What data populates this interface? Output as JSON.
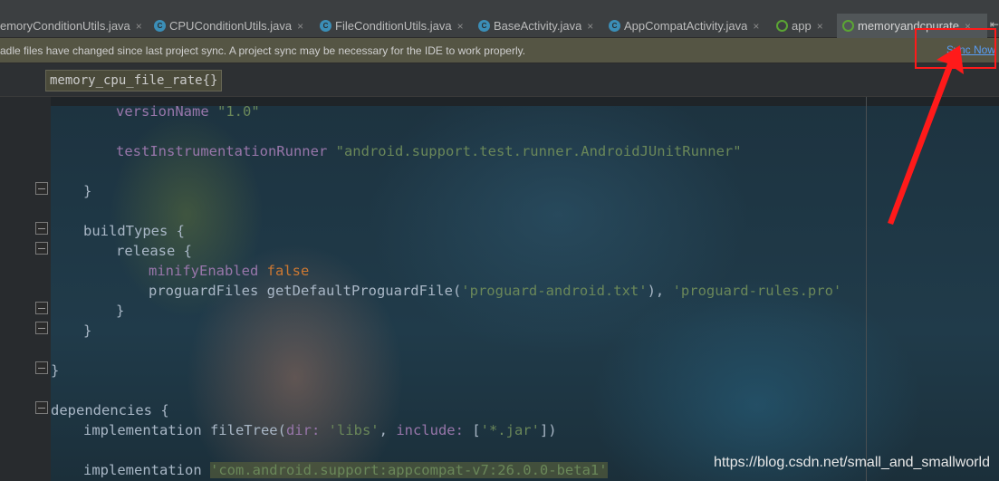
{
  "tabs": [
    {
      "label": "emoryConditionUtils.java",
      "icon": "java-class-icon",
      "active": false
    },
    {
      "label": "CPUConditionUtils.java",
      "icon": "java-class-icon",
      "active": false
    },
    {
      "label": "FileConditionUtils.java",
      "icon": "java-class-icon",
      "active": false
    },
    {
      "label": "BaseActivity.java",
      "icon": "java-class-icon",
      "active": false
    },
    {
      "label": "AppCompatActivity.java",
      "icon": "java-class-icon",
      "active": false
    },
    {
      "label": "app",
      "icon": "gradle-icon",
      "active": false
    },
    {
      "label": "memoryandcpurate",
      "icon": "gradle-icon",
      "active": true
    }
  ],
  "tab_close_glyph": "×",
  "tabs_overflow_glyph": "⇤",
  "notification": {
    "message": "adle files have changed since last project sync. A project sync may be necessary for the IDE to work properly.",
    "action_label": "Sync Now"
  },
  "breadcrumb": "memory_cpu_file_rate{}",
  "code": {
    "l1_prop": "versionName",
    "l1_str": "\"1.0\"",
    "l2_prop": "testInstrumentationRunner",
    "l2_str": "\"android.support.test.runner.AndroidJUnitRunner\"",
    "l3": "}",
    "l4": "buildTypes {",
    "l5": "release {",
    "l6_prop": "minifyEnabled",
    "l6_kw": "false",
    "l7_a": "proguardFiles getDefaultProguardFile(",
    "l7_s1": "'proguard-android.txt'",
    "l7_b": "), ",
    "l7_s2": "'proguard-rules.pro'",
    "l8": "}",
    "l9": "}",
    "l10": "}",
    "l11": "dependencies {",
    "l12_a": "implementation fileTree(",
    "l12_p1": "dir:",
    "l12_s1": "'libs'",
    "l12_b": ", ",
    "l12_p2": "include:",
    "l12_c": " [",
    "l12_s2": "'*.jar'",
    "l12_d": "])",
    "l13_a": "implementation ",
    "l13_s": "'com.android.support:appcompat-v7:26.0.0-beta1'"
  },
  "colors": {
    "annotation": "#ff1a1a",
    "link": "#589df6",
    "string": "#6a8759",
    "keyword": "#cc7832",
    "property": "#9876aa"
  },
  "watermark": "https://blog.csdn.net/small_and_smallworld"
}
